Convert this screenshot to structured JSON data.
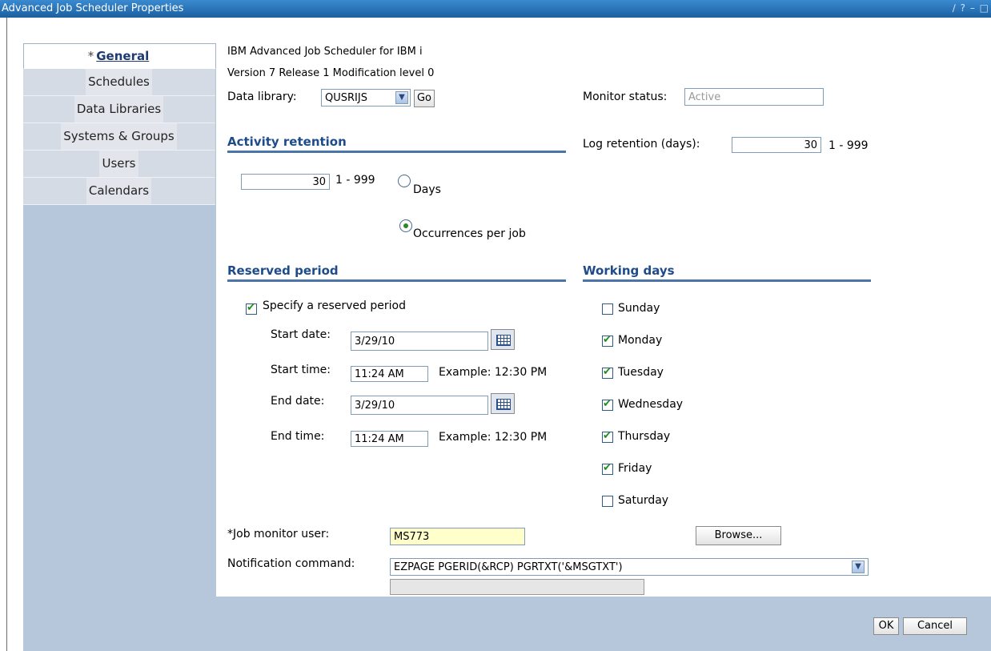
{
  "window": {
    "title": "Advanced Job Scheduler Properties",
    "controls": "∕ ? – □"
  },
  "tabs": [
    {
      "label": "General",
      "required_marker": "*"
    },
    {
      "label": "Schedules"
    },
    {
      "label": "Data Libraries"
    },
    {
      "label": "Systems & Groups"
    },
    {
      "label": "Users"
    },
    {
      "label": "Calendars"
    }
  ],
  "product": {
    "name": "IBM Advanced Job Scheduler for IBM i",
    "version": "Version 7 Release 1 Modification level 0"
  },
  "data_library": {
    "label": "Data library:",
    "value": "QUSRIJS",
    "go": "Go"
  },
  "monitor_status": {
    "label": "Monitor status:",
    "value": "Active"
  },
  "activity_retention": {
    "heading": "Activity retention",
    "value": "30",
    "range": "1 - 999",
    "option_days": "Days",
    "option_occurrences": "Occurrences per job",
    "selected": "Occurrences per job"
  },
  "log_retention": {
    "label": "Log retention (days):",
    "value": "30",
    "range": "1 - 999"
  },
  "reserved_period": {
    "heading": "Reserved period",
    "checkbox_label": "Specify a reserved period",
    "checked": true,
    "start_date_label": "Start date:",
    "start_date": "3/29/10",
    "start_time_label": "Start time:",
    "start_time": "11:24 AM",
    "start_example": "Example: 12:30 PM",
    "end_date_label": "End date:",
    "end_date": "3/29/10",
    "end_time_label": "End time:",
    "end_time": "11:24 AM",
    "end_example": "Example: 12:30 PM"
  },
  "working_days": {
    "heading": "Working days",
    "days": [
      {
        "label": "Sunday",
        "checked": false
      },
      {
        "label": "Monday",
        "checked": true
      },
      {
        "label": "Tuesday",
        "checked": true
      },
      {
        "label": "Wednesday",
        "checked": true
      },
      {
        "label": "Thursday",
        "checked": true
      },
      {
        "label": "Friday",
        "checked": true
      },
      {
        "label": "Saturday",
        "checked": false
      }
    ]
  },
  "job_monitor_user": {
    "marker": "*",
    "label": "Job monitor user:",
    "value": "MS773",
    "browse": "Browse..."
  },
  "notification_command": {
    "label": "Notification command:",
    "value": "EZPAGE PGERID(&RCP) PGRTXT('&MSGTXT')",
    "extra": ""
  },
  "footer": {
    "ok": "OK",
    "cancel": "Cancel"
  },
  "colors": {
    "titlebar": "#1f6fb5",
    "sidebar": "#b7c7db",
    "required_field": "#ffffcc",
    "section_heading": "#1e4b8a"
  }
}
